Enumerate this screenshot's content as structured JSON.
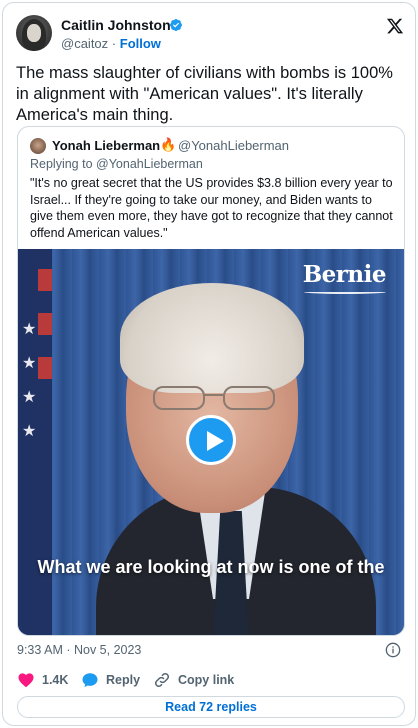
{
  "author": {
    "name": "Caitlin Johnstone",
    "handle": "@caitoz",
    "separator": "·",
    "follow_label": "Follow"
  },
  "tweet": {
    "text": "The mass slaughter of civilians with bombs is 100% in alignment with \"American values\". It's literally America's main thing."
  },
  "quoted": {
    "name": "Yonah Lieberman",
    "emoji": "🔥",
    "handle": "@YonahLieberman",
    "replying_prefix": "Replying to",
    "replying_handle": "@YonahLieberman",
    "text": "\"It's no great secret that the US provides $3.8 billion every year to Israel... If they're going to take our money, and Biden wants to give them even more, they have got to recognize that they cannot offend American values.\"",
    "media": {
      "logo_text": "Bernie",
      "caption": "What we are looking at now is one of the"
    }
  },
  "meta": {
    "timestamp": "9:33 AM · Nov 5, 2023"
  },
  "actions": {
    "likes": "1.4K",
    "reply_label": "Reply",
    "copy_label": "Copy link",
    "read_replies": "Read 72 replies"
  },
  "icons": {
    "verified": "verified-badge-icon",
    "x_logo": "x-logo-icon",
    "play": "play-icon",
    "info": "info-icon",
    "heart": "heart-icon",
    "reply": "reply-icon",
    "link": "link-icon"
  },
  "colors": {
    "accent": "#1d9bf0",
    "link": "#006fd6",
    "heart": "#f91880",
    "muted": "#536471",
    "text": "#0f1419"
  }
}
